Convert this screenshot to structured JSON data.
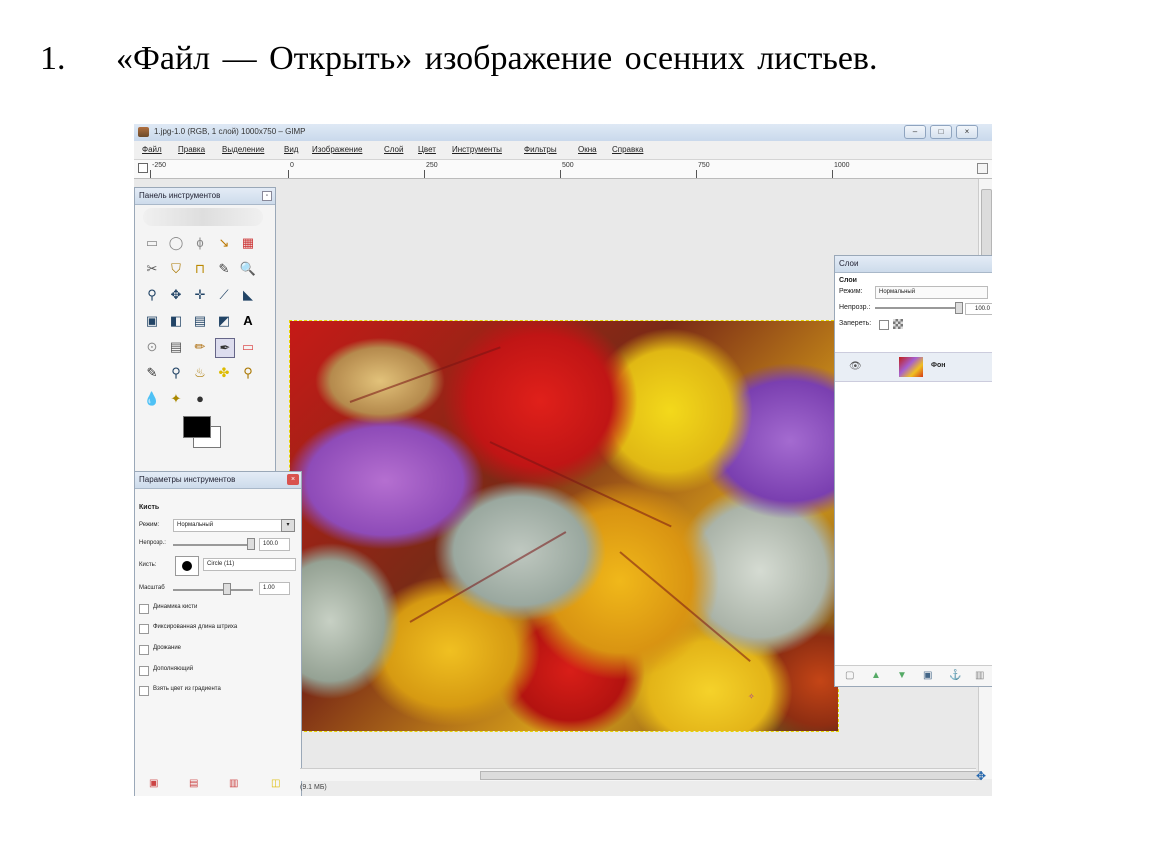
{
  "slide": {
    "number": "1.",
    "heading": "«Файл — Открыть» изображение осенних листьев."
  },
  "window": {
    "title": "1.jpg-1.0 (RGB, 1 слой) 1000x750 – GIMP",
    "buttons": [
      "–",
      "□",
      "×"
    ]
  },
  "menu": [
    "Файл",
    "Правка",
    "Выделение",
    "Вид",
    "Изображение",
    "Слой",
    "Цвет",
    "Инструменты",
    "Фильтры",
    "Окна",
    "Справка"
  ],
  "ruler": {
    "labels": [
      "-250",
      "0",
      "250",
      "500",
      "750",
      "1000"
    ]
  },
  "toolbox": {
    "title": "Панель инструментов",
    "tools": [
      "▭",
      "◯",
      "ϕ",
      "↘",
      "▦",
      "✂",
      "⛉",
      "⊓",
      "✎",
      "🔍",
      "⚲",
      "✥",
      "✛",
      "⟋",
      "◣",
      "▣",
      "◧",
      "▤",
      "◩",
      "A",
      "⊙",
      "▤",
      "✏",
      "✒",
      "▭",
      "✎",
      "⚲",
      "♨",
      "✤",
      "⚲",
      "💧",
      "✦",
      "●"
    ],
    "fg_color": "#000000",
    "bg_color": "#ffffff"
  },
  "tool_options": {
    "title": "Параметры инструментов",
    "tool_name": "Кисть",
    "mode_label": "Режим:",
    "mode_value": "Нормальный",
    "opacity_label": "Непрозр.:",
    "opacity_value": "100.0",
    "brush_label": "Кисть:",
    "brush_value": "Circle (11)",
    "scale_label": "Масштаб",
    "scale_value": "1.00",
    "checkboxes": [
      "Динамика кисти",
      "Фиксированная длина штриха",
      "Дрожание",
      "Дополняющий",
      "Взять цвет из градиента"
    ]
  },
  "layers": {
    "window_title": "Слои",
    "tab_label": "Слои",
    "mode_label": "Режим:",
    "mode_value": "Нормальный",
    "opacity_label": "Непрозр.:",
    "opacity_value": "100.0",
    "lock_label": "Запереть:",
    "layer_name": "Фон"
  },
  "status": {
    "text": "(9.1 ΜБ)"
  }
}
